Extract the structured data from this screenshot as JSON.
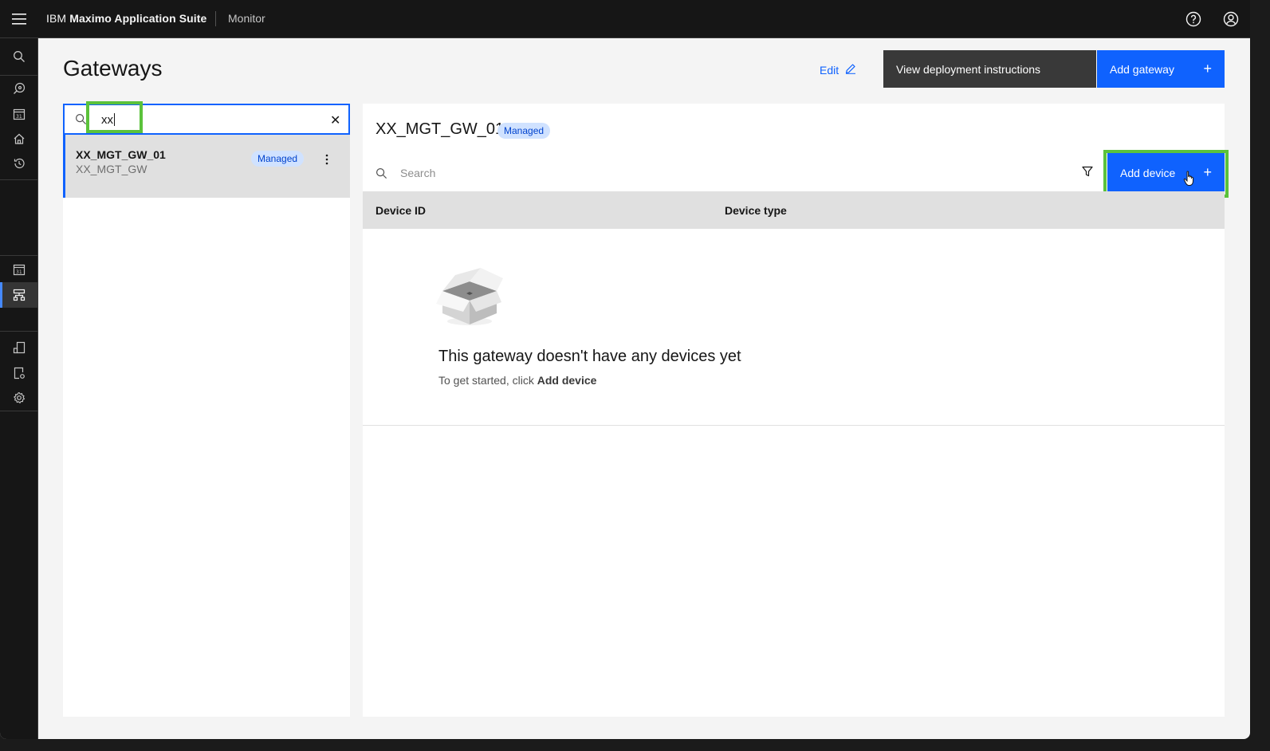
{
  "header": {
    "brand_prefix": "IBM",
    "brand_name": "Maximo Application Suite",
    "app_name": "Monitor"
  },
  "sidenav": {
    "icons": [
      "search-icon",
      "gauge-icon",
      "calendar-icon",
      "home-icon",
      "history-icon",
      "calendar-icon",
      "gateway-icon",
      "device-icon",
      "device-settings-icon",
      "settings-icon"
    ],
    "active": "gateway-icon"
  },
  "page": {
    "title": "Gateways",
    "edit_label": "Edit",
    "view_instructions_label": "View deployment instructions",
    "add_gateway_label": "Add gateway"
  },
  "gateway_list": {
    "search_value": "xx",
    "items": [
      {
        "name": "XX_MGT_GW_01",
        "subtitle": "XX_MGT_GW",
        "tag": "Managed"
      }
    ]
  },
  "detail": {
    "title": "XX_MGT_GW_01",
    "tag": "Managed",
    "search_placeholder": "Search",
    "add_device_label": "Add device",
    "columns": [
      "Device ID",
      "Device type"
    ],
    "empty_title": "This gateway doesn't have any devices yet",
    "empty_sub_prefix": "To get started, click ",
    "empty_sub_action": "Add device"
  },
  "colors": {
    "primary": "#0f62fe",
    "highlight": "#5bc23b",
    "header_bg": "#161616",
    "tag_bg": "#d0e2ff"
  }
}
